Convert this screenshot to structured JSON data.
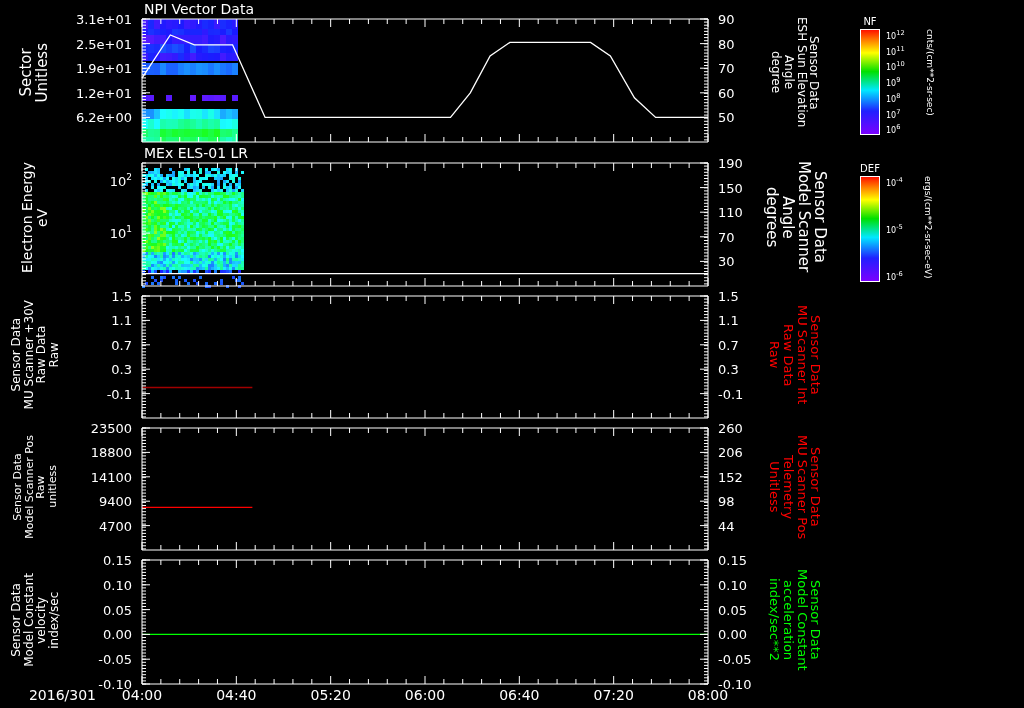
{
  "panels": [
    {
      "title": "NPI Vector Data",
      "left_axis": {
        "label": [
          "Sector",
          "Unitless"
        ],
        "ticks": [
          "3.1e+01",
          "2.5e+01",
          "1.9e+01",
          "1.2e+01",
          "6.2e+00"
        ]
      },
      "right_axis": {
        "label": [
          "Sensor Data",
          "ESH Sun Elevation",
          "Angle",
          "degree"
        ],
        "color": "#ffffff"
      },
      "colorbar": {
        "title": "NF",
        "ticks": [
          "10$^{12}$",
          "10$^{11}$",
          "10$^{10}$",
          "10$^{9}$",
          "10$^{8}$",
          "10$^{7}$",
          "10$^{6}$"
        ],
        "unit": "cnts/(cm**2-sr-sec)"
      },
      "chart_data": {
        "type": "line",
        "x": [
          4.0,
          4.2,
          4.37,
          4.64,
          4.87,
          6.18,
          6.32,
          6.46,
          6.6,
          7.17,
          7.31,
          7.48,
          7.63,
          8.0
        ],
        "xlim": [
          4,
          8
        ],
        "ylim": [
          40,
          90
        ],
        "yticks": [
          {
            "value": 90,
            "label": "90"
          },
          {
            "value": 80,
            "label": "80"
          },
          {
            "value": 70,
            "label": "70"
          },
          {
            "value": 60,
            "label": "60"
          },
          {
            "value": 50,
            "label": "50"
          }
        ],
        "series": [
          {
            "color": "#ffffff",
            "values": [
              66,
              83.5,
              79.5,
              79.5,
              50,
              50,
              60,
              75,
              80.5,
              80.5,
              75,
              58,
              50,
              50
            ]
          }
        ]
      }
    },
    {
      "title": "MEx ELS-01 LR",
      "left_axis": {
        "label": [
          "Electron Energy",
          "eV"
        ],
        "ticks": [
          "10$^{2}$",
          "10$^{1}$"
        ]
      },
      "right_axis": {
        "label": [
          "Sensor Data",
          "Model Scanner",
          "Angle",
          "degrees"
        ],
        "color": "#ffffff"
      },
      "colorbar": {
        "title": "DEF",
        "ticks": [
          "10$^{-4}$",
          "10$^{-5}$",
          "10$^{-6}$"
        ],
        "unit": "ergs/(cm**2-sr-sec-eV)"
      },
      "chart_data": {
        "type": "line",
        "x": [
          4.0,
          8.0
        ],
        "xlim": [
          4,
          8
        ],
        "ylim": [
          -10,
          190
        ],
        "yticks": [
          {
            "value": 190,
            "label": "190"
          },
          {
            "value": 150,
            "label": "150"
          },
          {
            "value": 110,
            "label": "110"
          },
          {
            "value": 70,
            "label": "70"
          },
          {
            "value": 30,
            "label": "30"
          }
        ],
        "series": [
          {
            "color": "#ffffff",
            "values": [
              10,
              10
            ]
          }
        ]
      }
    },
    {
      "left_axis": {
        "label": [
          "Sensor Data",
          "MU Scanner +30V",
          "Raw Data",
          "Raw"
        ]
      },
      "right_axis": {
        "label": [
          "Sensor Data",
          "MU Scanner Int",
          "Raw Data",
          "Raw"
        ],
        "color": "#ff0000",
        "ticks": [
          "1.5",
          "1.1",
          "0.7",
          "0.3",
          "-0.1"
        ]
      },
      "chart_data": {
        "type": "line",
        "x": [
          4.0,
          4.78
        ],
        "xlim": [
          4,
          8
        ],
        "ylim": [
          -0.5,
          1.5
        ],
        "yticks": [
          {
            "value": 1.5,
            "label": "1.5"
          },
          {
            "value": 1.1,
            "label": "1.1"
          },
          {
            "value": 0.7,
            "label": "0.7"
          },
          {
            "value": 0.3,
            "label": "0.3"
          },
          {
            "value": -0.1,
            "label": "-0.1"
          }
        ],
        "series": [
          {
            "color": "#a00000",
            "values": [
              0.0,
              0.0
            ]
          }
        ]
      }
    },
    {
      "left_axis": {
        "label": [
          "Sensor Data",
          "Model Scanner Pos",
          "Raw",
          "unitless"
        ]
      },
      "right_axis": {
        "label": [
          "Sensor Data",
          "MU Scanner Pos",
          "Telemetry",
          "Unitless"
        ],
        "color": "#ff0000",
        "ticks": [
          "260",
          "206",
          "152",
          "98",
          "44"
        ]
      },
      "chart_data": {
        "type": "line",
        "x": [
          4.0,
          4.78
        ],
        "xlim": [
          4,
          8
        ],
        "ylim": [
          0,
          23500
        ],
        "yticks": [
          {
            "value": 23500,
            "label": "23500"
          },
          {
            "value": 18800,
            "label": "18800"
          },
          {
            "value": 14100,
            "label": "14100"
          },
          {
            "value": 9400,
            "label": "9400"
          },
          {
            "value": 4700,
            "label": "4700"
          }
        ],
        "series": [
          {
            "color": "#ff0000",
            "values": [
              8200,
              8200
            ]
          }
        ]
      }
    },
    {
      "left_axis": {
        "label": [
          "Sensor Data",
          "Model Constant",
          "velocity",
          "index/sec"
        ]
      },
      "right_axis": {
        "label": [
          "Sensor Data",
          "Model Constant",
          "acceleration",
          "index/sec**2"
        ],
        "color": "#00ff00",
        "ticks": [
          "0.15",
          "0.10",
          "0.05",
          "0.00",
          "-0.05",
          "-0.10"
        ]
      },
      "chart_data": {
        "type": "line",
        "x": [
          4.0,
          8.0
        ],
        "xlim": [
          4,
          8
        ],
        "xticks": [
          {
            "value": 4,
            "label": "04:00"
          },
          {
            "value": 4.6667,
            "label": "04:40"
          },
          {
            "value": 5.3333,
            "label": "05:20"
          },
          {
            "value": 6,
            "label": "06:00"
          },
          {
            "value": 6.6667,
            "label": "06:40"
          },
          {
            "value": 7.3333,
            "label": "07:20"
          },
          {
            "value": 8,
            "label": "08:00"
          }
        ],
        "ylim": [
          -0.1,
          0.15
        ],
        "yticks": [
          {
            "value": 0.15,
            "label": "0.15"
          },
          {
            "value": 0.1,
            "label": "0.10"
          },
          {
            "value": 0.05,
            "label": "0.05"
          },
          {
            "value": 0,
            "label": "0.00"
          },
          {
            "value": -0.05,
            "label": "-0.05"
          },
          {
            "value": -0.1,
            "label": "-0.10"
          }
        ],
        "series": [
          {
            "color": "#00ff00",
            "values": [
              0,
              0
            ]
          }
        ]
      }
    }
  ],
  "time_axis": {
    "date": "2016/301"
  }
}
